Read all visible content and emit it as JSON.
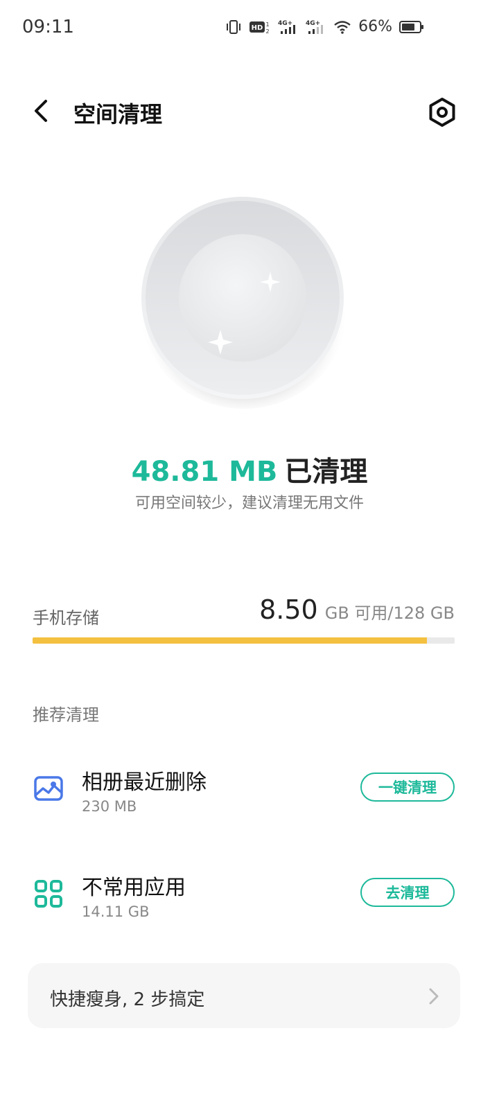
{
  "status_bar": {
    "time": "09:11",
    "battery_percent": "66%",
    "network_1": "4G+",
    "network_2": "4G+",
    "hd_label": "HD"
  },
  "header": {
    "title": "空间清理"
  },
  "cleaned": {
    "amount": "48.81 MB",
    "label": "已清理",
    "subtitle": "可用空间较少，建议清理无用文件"
  },
  "storage": {
    "label": "手机存储",
    "free": "8.50",
    "unit_text": "GB 可用/128 GB",
    "used_fraction": 0.934
  },
  "recommend": {
    "section_title": "推荐清理",
    "items": [
      {
        "title": "相册最近删除",
        "size": "230 MB",
        "button": "一键清理",
        "icon": "photo-album-icon"
      },
      {
        "title": "不常用应用",
        "size": "14.11 GB",
        "button": "去清理",
        "icon": "apps-grid-icon"
      }
    ]
  },
  "quick": {
    "label": "快捷瘦身, 2 步搞定"
  },
  "colors": {
    "accent": "#1db99a",
    "storage_bar": "#f4c03f",
    "icon_blue": "#4a78e8"
  }
}
